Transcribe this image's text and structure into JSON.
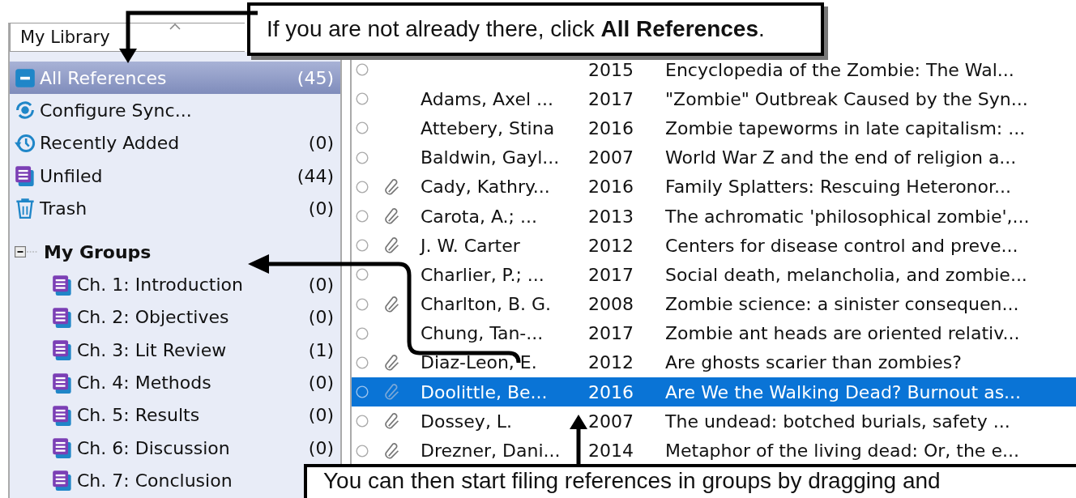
{
  "library_dropdown": {
    "value": "My Library"
  },
  "sidebar": {
    "items": [
      {
        "label": "All References",
        "count": "(45)",
        "selected": true
      },
      {
        "label": "Configure Sync...",
        "selected": false
      },
      {
        "label": "Recently Added",
        "count": "(0)",
        "selected": false
      },
      {
        "label": "Unfiled",
        "count": "(44)",
        "selected": false
      },
      {
        "label": "Trash",
        "count": "(0)",
        "selected": false
      }
    ],
    "groups": {
      "label": "My Groups",
      "expanded": true,
      "children": [
        {
          "label": "Ch. 1: Introduction",
          "count": "(0)",
          "selected": false
        },
        {
          "label": "Ch. 2: Objectives",
          "count": "(0)",
          "selected": false
        },
        {
          "label": "Ch. 3: Lit Review",
          "count": "(1)",
          "selected": false
        },
        {
          "label": "Ch. 4: Methods",
          "count": "(0)",
          "selected": false
        },
        {
          "label": "Ch. 5: Results",
          "count": "(0)",
          "selected": false
        },
        {
          "label": "Ch. 6: Discussion",
          "count": "(0)",
          "selected": false
        },
        {
          "label": "Ch. 7: Conclusion",
          "selected": false
        }
      ]
    }
  },
  "references": {
    "rows": [
      {
        "attachment": false,
        "year": "2015",
        "title": "Encyclopedia of the Zombie: The Wal...",
        "selected": false
      },
      {
        "attachment": false,
        "author": "Adams, Axel ...",
        "year": "2017",
        "title": "\"Zombie\" Outbreak Caused by the Syn...",
        "selected": false
      },
      {
        "attachment": false,
        "author": "Attebery, Stina",
        "year": "2016",
        "title": "Zombie tapeworms in late capitalism: ...",
        "selected": false
      },
      {
        "attachment": false,
        "author": "Baldwin, Gayl...",
        "year": "2007",
        "title": "World War Z and the end of religion a...",
        "selected": false
      },
      {
        "attachment": true,
        "author": "Cady, Kathry...",
        "year": "2016",
        "title": "Family Splatters: Rescuing Heteronor...",
        "selected": false
      },
      {
        "attachment": true,
        "author": "Carota, A.; ...",
        "year": "2013",
        "title": "The achromatic 'philosophical zombie',...",
        "selected": false
      },
      {
        "attachment": true,
        "author": "J. W. Carter",
        "year": "2012",
        "title": "Centers for disease control and preve...",
        "selected": false
      },
      {
        "attachment": false,
        "author": "Charlier, P.; ...",
        "year": "2017",
        "title": "Social death, melancholia, and zombie...",
        "selected": false
      },
      {
        "attachment": true,
        "author": "Charlton, B. G.",
        "year": "2008",
        "title": "Zombie science: a sinister consequen...",
        "selected": false
      },
      {
        "attachment": false,
        "author": "Chung, Tan-...",
        "year": "2017",
        "title": "Zombie ant heads are oriented relativ...",
        "selected": false
      },
      {
        "attachment": true,
        "author": "Diaz-Leon, E.",
        "year": "2012",
        "title": "Are ghosts scarier than zombies?",
        "selected": false
      },
      {
        "attachment": true,
        "author": "Doolittle, Be...",
        "year": "2016",
        "title": "Are We the Walking Dead? Burnout as...",
        "selected": true
      },
      {
        "attachment": true,
        "author": "Dossey, L.",
        "year": "2007",
        "title": "The undead: botched burials, safety ...",
        "selected": false
      },
      {
        "attachment": true,
        "author": "Drezner, Dani...",
        "year": "2014",
        "title": "Metaphor of the living dead: Or, the e...",
        "selected": false
      }
    ]
  },
  "callouts": [
    {
      "text": "If you are not already there, click **All References**."
    },
    {
      "text": "You can then start filing references in groups by dragging and"
    }
  ]
}
